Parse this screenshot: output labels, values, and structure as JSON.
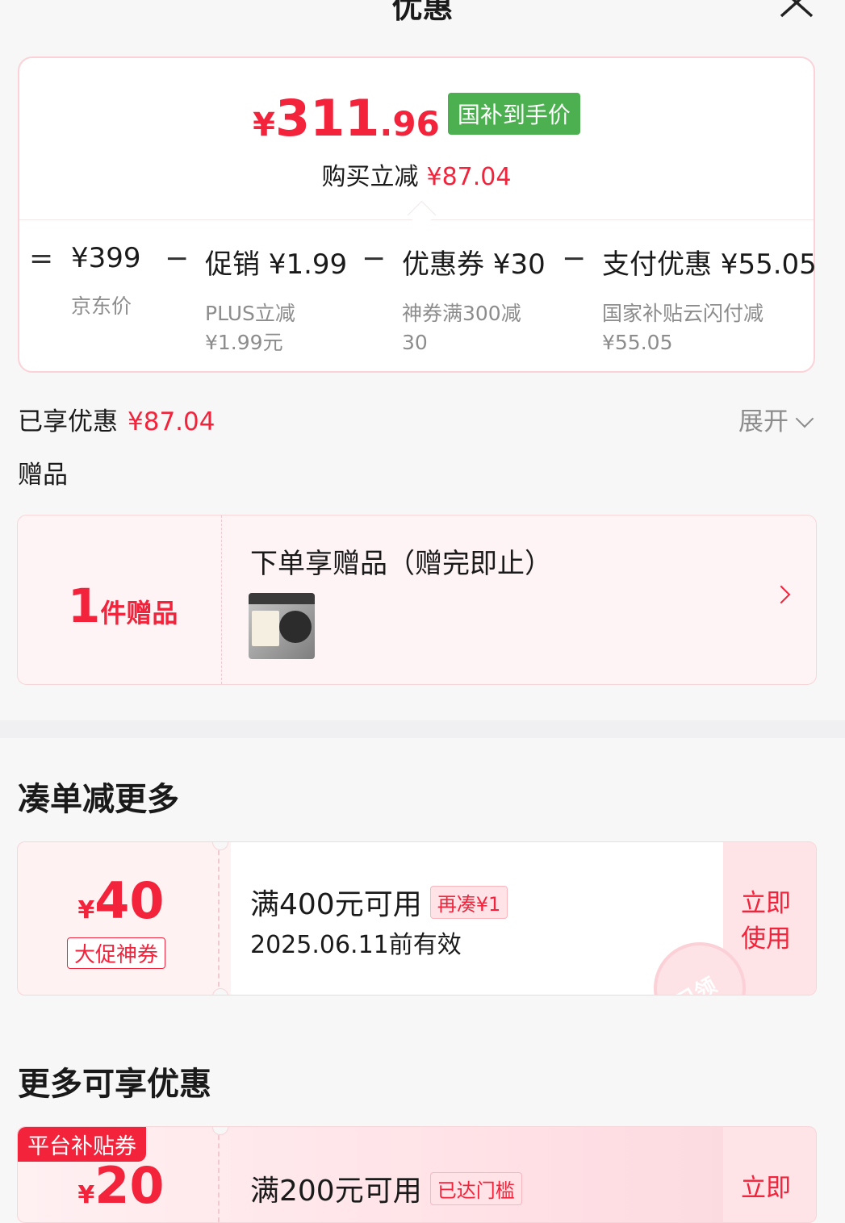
{
  "header": {
    "title": "优惠"
  },
  "price_card": {
    "currency": "¥",
    "price_int": "311",
    "price_dec": ".96",
    "badge": "国补到手价",
    "save_label": "购买立减",
    "save_amount": "¥87.04",
    "formula": {
      "eq": "=",
      "minus": "−",
      "items": [
        {
          "main": "¥399",
          "sub1": "京东价",
          "sub2": ""
        },
        {
          "main": "促销 ¥1.99",
          "sub1": "PLUS立减",
          "sub2": "¥1.99元"
        },
        {
          "main": "优惠券 ¥30",
          "sub1": "神券满300减",
          "sub2": "30"
        },
        {
          "main": "支付优惠 ¥55.05",
          "sub1": "国家补贴云闪付减",
          "sub2": "¥55.05"
        }
      ]
    }
  },
  "enjoyed": {
    "label": "已享优惠",
    "amount": "¥87.04",
    "expand": "展开"
  },
  "gift": {
    "section_label": "赠品",
    "count": "1",
    "count_unit": "件赠品",
    "title": "下单享赠品（赠完即止）"
  },
  "more_deals": {
    "title": "凑单减更多",
    "coupon": {
      "currency": "¥",
      "value": "40",
      "tag": "大促神券",
      "condition": "满400元可用",
      "badge": "再凑¥1",
      "date": "2025.06.11前有效",
      "button": [
        "立即",
        "使用"
      ],
      "stamp": "已领"
    }
  },
  "more_offers": {
    "title": "更多可享优惠",
    "coupon": {
      "platform_tag": "平台补贴券",
      "currency": "¥",
      "value": "20",
      "condition": "满200元可用",
      "badge": "已达门槛",
      "button": [
        "立即"
      ]
    }
  },
  "colors": {
    "accent": "#f2233b",
    "gov_badge": "#4caf50",
    "card_border": "#fcd2d8"
  }
}
